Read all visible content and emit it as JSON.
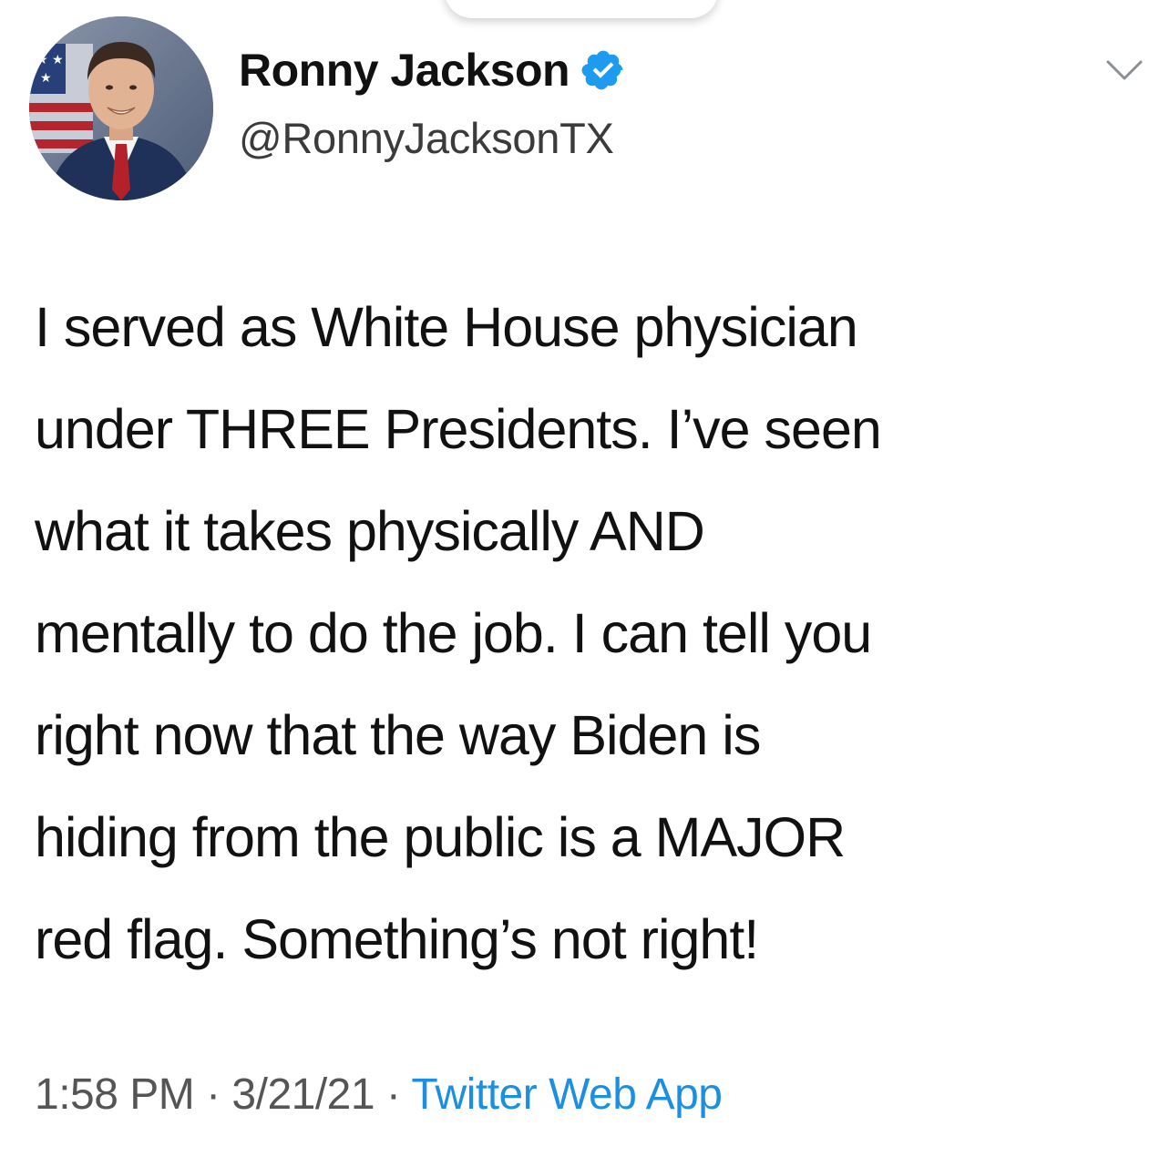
{
  "profile": {
    "display_name": "Ronny Jackson",
    "handle": "@RonnyJacksonTX",
    "verified": true
  },
  "tweet": {
    "lines": [
      "I served as White House physician",
      "under THREE Presidents. I’ve seen",
      "what it takes physically AND",
      "mentally to do the job. I can tell you",
      "right now that the way Biden is",
      "hiding from the public is a MAJOR",
      "red flag. Something’s not right!"
    ]
  },
  "meta": {
    "time": "1:58 PM",
    "separator": " · ",
    "date": "3/21/21",
    "source": "Twitter Web App"
  },
  "colors": {
    "verified_badge": "#1d9bf0",
    "link": "#1d8fe0"
  },
  "icons": {
    "verified": "verified-badge-icon",
    "menu": "chevron-down-icon"
  }
}
